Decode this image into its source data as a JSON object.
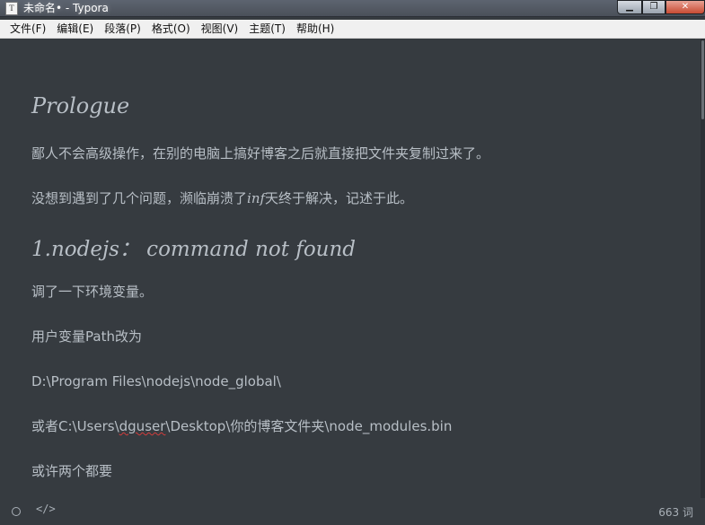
{
  "window": {
    "title": "未命名• - Typora",
    "icon_glyph": "T",
    "controls": {
      "minimize": "▁",
      "maximize": "❐",
      "close": "✕"
    }
  },
  "menubar": {
    "items": [
      "文件(F)",
      "编辑(E)",
      "段落(P)",
      "格式(O)",
      "视图(V)",
      "主题(T)",
      "帮助(H)"
    ]
  },
  "document": {
    "heading1": "Prologue",
    "para1": "鄙人不会高级操作，在别的电脑上搞好博客之后就直接把文件夹复制过来了。",
    "para2_before": "没想到遇到了几个问题，濒临崩溃了",
    "para2_math": "inf",
    "para2_after": "天终于解决，记述于此。",
    "heading2": "1.nodejs： command not found",
    "para3": "调了一下环境变量。",
    "para4": "用户变量Path改为",
    "para5": "D:\\Program Files\\nodejs\\node_global\\",
    "para6_before": "或者C:\\Users\\",
    "para6_underlined": "dguser",
    "para6_after": "\\Desktop\\你的博客文件夹\\node_modules.bin",
    "para7": "或许两个都要"
  },
  "footer": {
    "code_toggle": "</>",
    "word_count": "663 词"
  }
}
